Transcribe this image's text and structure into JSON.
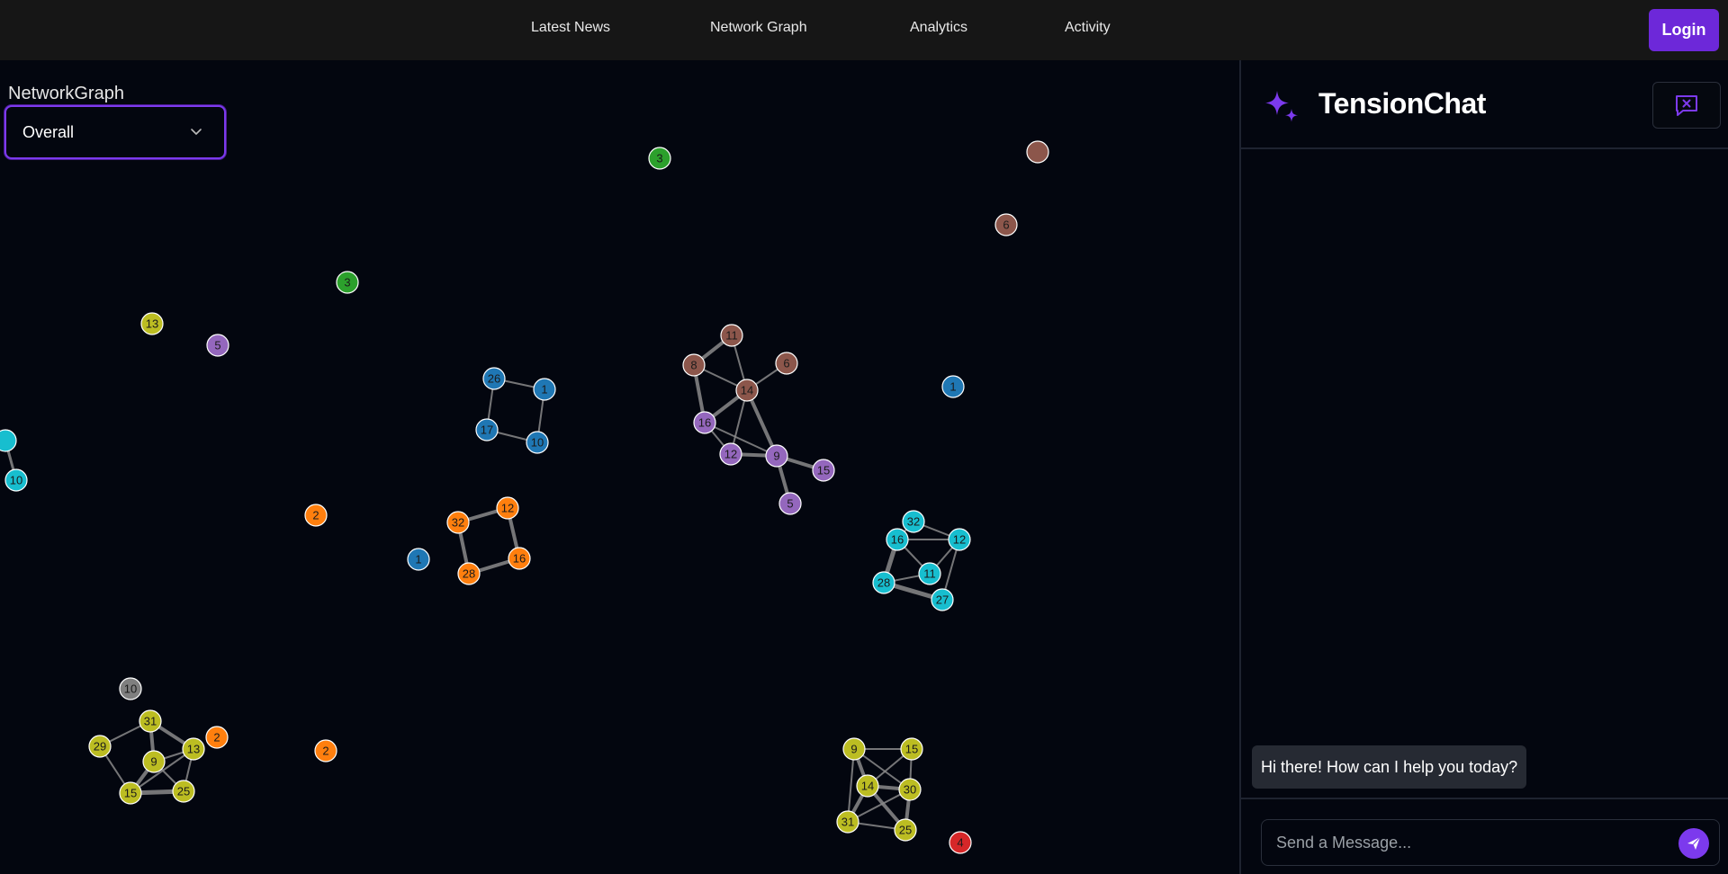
{
  "nav": {
    "items": [
      "Latest News",
      "Network Graph",
      "Analytics",
      "Activity"
    ],
    "login_label": "Login"
  },
  "graph": {
    "title": "NetworkGraph",
    "selected_view": "Overall",
    "nodes": [
      {
        "id": "g3top",
        "label": "3",
        "color": "#2ca02c"
      },
      {
        "id": "b6top",
        "label": "",
        "color": "#8c564b"
      },
      {
        "id": "b6",
        "label": "6",
        "color": "#8c564b"
      },
      {
        "id": "g3",
        "label": "3",
        "color": "#2ca02c"
      },
      {
        "id": "y13",
        "label": "13",
        "color": "#bcbd22"
      },
      {
        "id": "p5",
        "label": "5",
        "color": "#9467bd"
      },
      {
        "id": "bl26",
        "label": "26",
        "color": "#1f77b4"
      },
      {
        "id": "bl1a",
        "label": "1",
        "color": "#1f77b4"
      },
      {
        "id": "bl17",
        "label": "17",
        "color": "#1f77b4"
      },
      {
        "id": "bl10",
        "label": "10",
        "color": "#1f77b4"
      },
      {
        "id": "br11",
        "label": "11",
        "color": "#8c564b"
      },
      {
        "id": "br8",
        "label": "8",
        "color": "#8c564b"
      },
      {
        "id": "br6b",
        "label": "6",
        "color": "#8c564b"
      },
      {
        "id": "br14",
        "label": "14",
        "color": "#8c564b"
      },
      {
        "id": "p16",
        "label": "16",
        "color": "#9467bd"
      },
      {
        "id": "p12",
        "label": "12",
        "color": "#9467bd"
      },
      {
        "id": "p9",
        "label": "9",
        "color": "#9467bd"
      },
      {
        "id": "p15",
        "label": "15",
        "color": "#9467bd"
      },
      {
        "id": "p5b",
        "label": "5",
        "color": "#9467bd"
      },
      {
        "id": "bl1b",
        "label": "1",
        "color": "#1f77b4"
      },
      {
        "id": "c-left",
        "label": "",
        "color": "#17becf"
      },
      {
        "id": "c10",
        "label": "10",
        "color": "#17becf"
      },
      {
        "id": "o2a",
        "label": "2",
        "color": "#ff7f0e"
      },
      {
        "id": "bl1c",
        "label": "1",
        "color": "#1f77b4"
      },
      {
        "id": "o32",
        "label": "32",
        "color": "#ff7f0e"
      },
      {
        "id": "o12",
        "label": "12",
        "color": "#ff7f0e"
      },
      {
        "id": "o28",
        "label": "28",
        "color": "#ff7f0e"
      },
      {
        "id": "o16",
        "label": "16",
        "color": "#ff7f0e"
      },
      {
        "id": "c32",
        "label": "32",
        "color": "#17becf"
      },
      {
        "id": "c16",
        "label": "16",
        "color": "#17becf"
      },
      {
        "id": "c12",
        "label": "12",
        "color": "#17becf"
      },
      {
        "id": "c11",
        "label": "11",
        "color": "#17becf"
      },
      {
        "id": "c28",
        "label": "28",
        "color": "#17becf"
      },
      {
        "id": "c27",
        "label": "27",
        "color": "#17becf"
      },
      {
        "id": "gr10",
        "label": "10",
        "color": "#7f7f7f"
      },
      {
        "id": "y31",
        "label": "31",
        "color": "#bcbd22"
      },
      {
        "id": "y29",
        "label": "29",
        "color": "#bcbd22"
      },
      {
        "id": "y9",
        "label": "9",
        "color": "#bcbd22"
      },
      {
        "id": "y13b",
        "label": "13",
        "color": "#bcbd22"
      },
      {
        "id": "o2b",
        "label": "2",
        "color": "#ff7f0e"
      },
      {
        "id": "y15",
        "label": "15",
        "color": "#bcbd22"
      },
      {
        "id": "y25",
        "label": "25",
        "color": "#bcbd22"
      },
      {
        "id": "o2c",
        "label": "2",
        "color": "#ff7f0e"
      },
      {
        "id": "y9b",
        "label": "9",
        "color": "#bcbd22"
      },
      {
        "id": "y15b",
        "label": "15",
        "color": "#bcbd22"
      },
      {
        "id": "y14",
        "label": "14",
        "color": "#bcbd22"
      },
      {
        "id": "y30",
        "label": "30",
        "color": "#bcbd22"
      },
      {
        "id": "y31b",
        "label": "31",
        "color": "#bcbd22"
      },
      {
        "id": "y25b",
        "label": "25",
        "color": "#bcbd22"
      },
      {
        "id": "r4",
        "label": "4",
        "color": "#d62728"
      }
    ]
  },
  "chat": {
    "title": "TensionChat",
    "greeting": "Hi there! How can I help you today?",
    "input_placeholder": "Send a Message...",
    "accent": "#7c3aed"
  }
}
